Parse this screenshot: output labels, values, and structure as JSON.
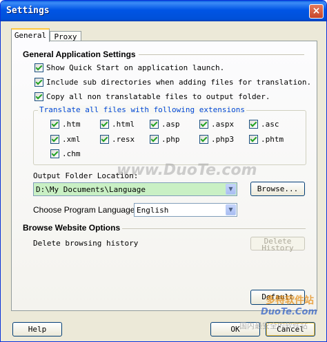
{
  "window": {
    "title": "Settings",
    "close_glyph": "×"
  },
  "tabs": [
    {
      "label": "General"
    },
    {
      "label": "Proxy"
    }
  ],
  "general_section": {
    "heading": "General Application Settings",
    "options": [
      {
        "label": "Show Quick Start on application launch.",
        "checked": true
      },
      {
        "label": "Include sub directories when adding files for translation.",
        "checked": true
      },
      {
        "label": "Copy all non translatable files to output folder.",
        "checked": true
      }
    ]
  },
  "extensions_group": {
    "legend": "Translate all files with following extensions",
    "items": [
      {
        "label": ".htm",
        "checked": true
      },
      {
        "label": ".html",
        "checked": true
      },
      {
        "label": ".asp",
        "checked": true
      },
      {
        "label": ".aspx",
        "checked": true
      },
      {
        "label": ".asc",
        "checked": true
      },
      {
        "label": ".xml",
        "checked": true
      },
      {
        "label": ".resx",
        "checked": true
      },
      {
        "label": ".php",
        "checked": true
      },
      {
        "label": ".php3",
        "checked": true
      },
      {
        "label": ".phtm",
        "checked": true
      },
      {
        "label": ".chm",
        "checked": true
      }
    ]
  },
  "output_folder": {
    "label": "Output Folder Location:",
    "value": "D:\\My Documents\\Language",
    "browse_label": "Browse..."
  },
  "program_language": {
    "label": "Choose Program Language:",
    "value": "English"
  },
  "browse_section": {
    "heading": "Browse Website Options",
    "delete_history_text": "Delete browsing history",
    "delete_history_button": "Delete History"
  },
  "buttons": {
    "default": "Default",
    "help": "Help",
    "ok": "OK",
    "cancel": "Cancel"
  },
  "watermark": {
    "center": "www.DuoTe.com",
    "corner_cn": "多特软件站",
    "corner_en": "DuoTe.Com",
    "corner_sub": "国内最安全的软件站"
  },
  "colors": {
    "titlebar": "#0055e5",
    "dialog_bg": "#ece9d8",
    "combo_highlight": "#c9f0c4",
    "check": "#21a121",
    "legend": "#0046d5"
  }
}
